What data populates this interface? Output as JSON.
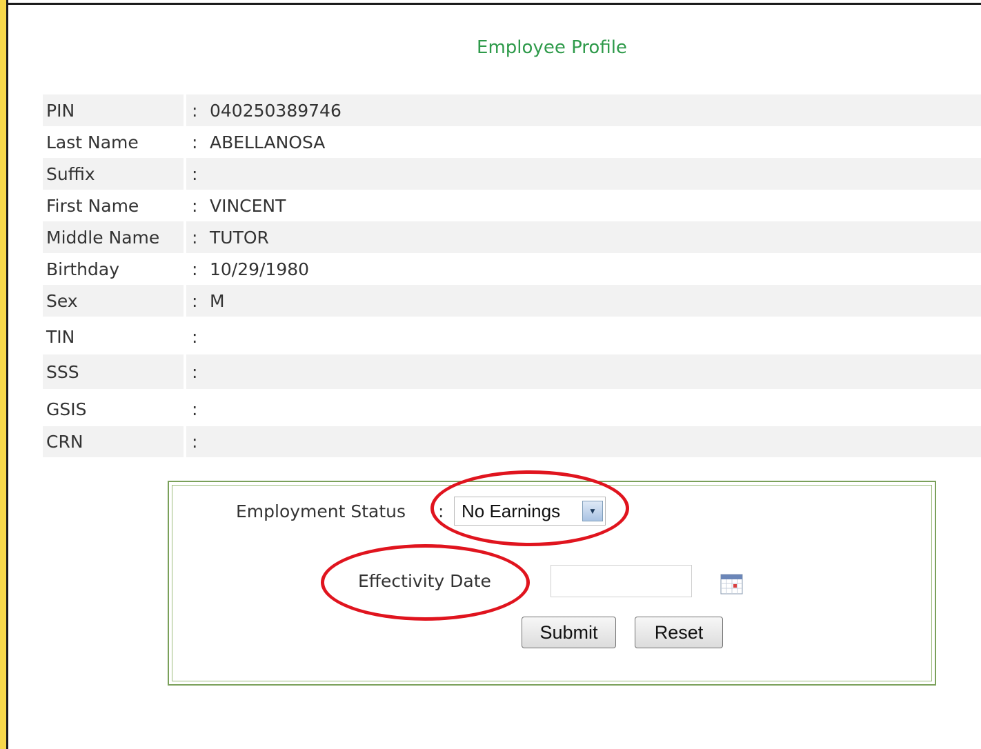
{
  "page": {
    "title": "Employee Profile"
  },
  "profile": {
    "rows": [
      {
        "label": "PIN",
        "value": "040250389746"
      },
      {
        "label": "Last Name",
        "value": "ABELLANOSA"
      },
      {
        "label": "Suffix",
        "value": ""
      },
      {
        "label": "First Name",
        "value": "VINCENT"
      },
      {
        "label": "Middle Name",
        "value": "TUTOR"
      },
      {
        "label": "Birthday",
        "value": "10/29/1980"
      },
      {
        "label": "Sex",
        "value": "M"
      },
      {
        "label": "TIN",
        "value": ""
      },
      {
        "label": "SSS",
        "value": ""
      },
      {
        "label": "GSIS",
        "value": ""
      },
      {
        "label": "CRN",
        "value": ""
      }
    ],
    "separator": ":"
  },
  "form": {
    "employment_status_label": "Employment Status",
    "employment_status_value": "No Earnings",
    "effectivity_date_label": "Effectivity Date",
    "effectivity_date_value": "",
    "submit_label": "Submit",
    "reset_label": "Reset"
  },
  "icons": {
    "dropdown": "chevron-down-icon",
    "calendar": "calendar-icon"
  },
  "colors": {
    "title": "#2e9a4a",
    "panel_border": "#7aa05a",
    "annotation": "#e0141e",
    "row_shade": "#f2f2f2"
  }
}
